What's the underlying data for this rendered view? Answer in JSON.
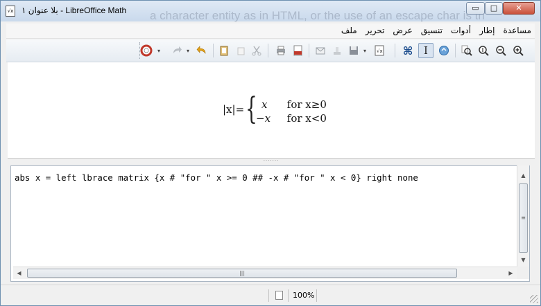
{
  "window": {
    "title": "بلا عنوان ١ - LibreOffice Math",
    "bg_ghost_text": "a character entity as in HTML, or the use of an escape char is th",
    "controls": {
      "minimize": "▭",
      "maximize": "□",
      "close": "✕"
    },
    "app_icon_text": "√x"
  },
  "menubar": {
    "items": [
      "ملف",
      "تحرير",
      "عرض",
      "تنسيق",
      "أدوات",
      "إطار",
      "مساعدة"
    ]
  },
  "toolbar": {
    "icons": [
      "help-icon",
      "dropdown-icon",
      "redo-icon",
      "undo-icon",
      "clipboard-icon",
      "copy-icon",
      "cut-icon",
      "print-icon",
      "pdf-icon",
      "mail-icon",
      "stamp-icon",
      "save-icon",
      "open-icon",
      "new-formula-icon",
      "symbols-icon",
      "cursor-icon",
      "update-icon",
      "zoom-page-icon",
      "zoom-original-icon",
      "zoom-out-icon",
      "zoom-in-icon"
    ]
  },
  "preview": {
    "lhs": "|x|=",
    "row1_value": "x",
    "row1_cond": "for x≥0",
    "row2_value": "−x",
    "row2_cond": "for x<0"
  },
  "splitter": "·······",
  "editor": {
    "command": "abs x = left lbrace matrix {x # \"for \" x >= 0 ## -x # \"for \" x < 0} right none"
  },
  "scroll": {
    "up": "▲",
    "down": "▼",
    "left": "◀",
    "right": "▶",
    "v_grip": "≡",
    "h_grip": "|||"
  },
  "status": {
    "zoom": "100%"
  }
}
